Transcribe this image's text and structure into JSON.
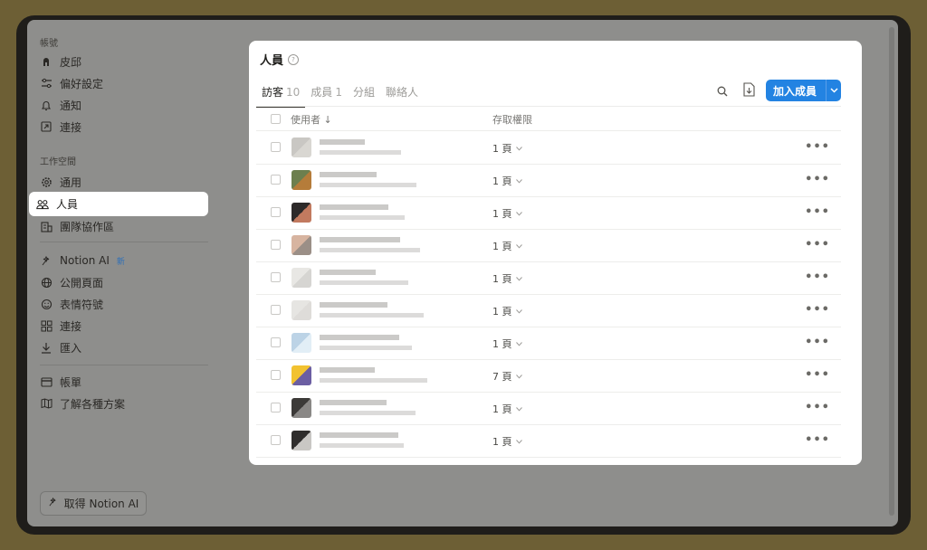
{
  "sidebar": {
    "account_label": "帳號",
    "account_items": [
      {
        "label": "皮邱",
        "icon": "user-icon"
      },
      {
        "label": "偏好設定",
        "icon": "sliders-icon"
      },
      {
        "label": "通知",
        "icon": "bell-icon"
      },
      {
        "label": "連接",
        "icon": "external-link-icon"
      }
    ],
    "workspace_label": "工作空間",
    "workspace_items": [
      {
        "label": "通用",
        "icon": "gear-icon"
      },
      {
        "label": "人員",
        "icon": "people-icon"
      },
      {
        "label": "團隊協作區",
        "icon": "building-icon"
      }
    ],
    "feature_items": [
      {
        "label": "Notion AI",
        "icon": "ai-icon",
        "badge": "新"
      },
      {
        "label": "公開頁面",
        "icon": "globe-icon"
      },
      {
        "label": "表情符號",
        "icon": "smile-icon"
      },
      {
        "label": "連接",
        "icon": "grid-icon"
      },
      {
        "label": "匯入",
        "icon": "download-icon"
      }
    ],
    "billing_items": [
      {
        "label": "帳單",
        "icon": "card-icon"
      },
      {
        "label": "了解各種方案",
        "icon": "map-icon"
      }
    ],
    "get_ai_label": "取得 Notion AI"
  },
  "modal": {
    "title": "人員",
    "tabs": [
      {
        "label": "訪客",
        "count": "10"
      },
      {
        "label": "成員",
        "count": "1"
      },
      {
        "label": "分組",
        "count": ""
      },
      {
        "label": "聯絡人",
        "count": ""
      }
    ],
    "add_button_label": "加入成員",
    "columns": {
      "user": "使用者 ↓",
      "access": "存取權限"
    },
    "rows": [
      {
        "access": "1 頁"
      },
      {
        "access": "1 頁"
      },
      {
        "access": "1 頁"
      },
      {
        "access": "1 頁"
      },
      {
        "access": "1 頁"
      },
      {
        "access": "1 頁"
      },
      {
        "access": "1 頁"
      },
      {
        "access": "7 頁"
      },
      {
        "access": "1 頁"
      },
      {
        "access": "1 頁"
      }
    ]
  },
  "colors": {
    "accent": "#2383e2",
    "backdrop": "#8e8e8c"
  }
}
